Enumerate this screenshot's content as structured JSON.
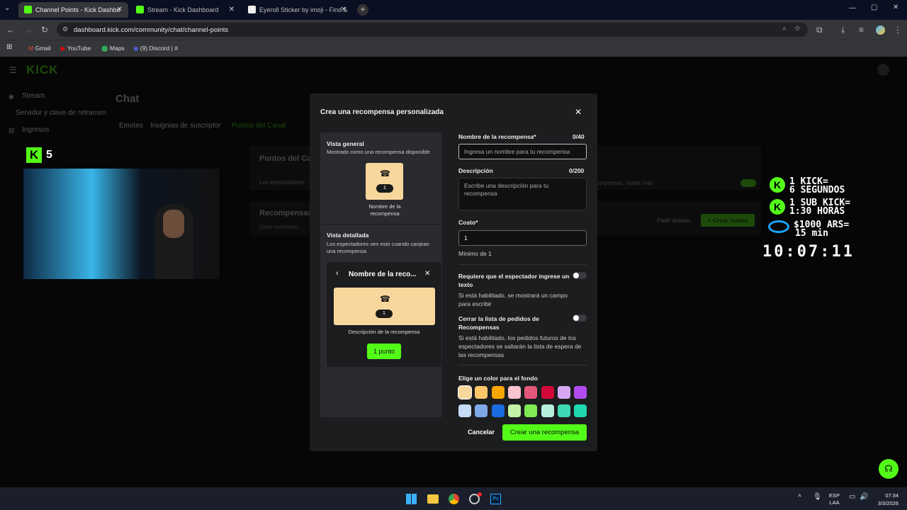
{
  "tabs": [
    {
      "label": "Channel Points - Kick Dashbo",
      "active": true
    },
    {
      "label": "Stream - Kick Dashboard",
      "active": false
    },
    {
      "label": "Eyeroll Sticker by imoji - Find &",
      "active": false
    }
  ],
  "address": {
    "url": "dashboard.kick.com/community/chat/channel-points"
  },
  "bookmarks": [
    "Gmail",
    "YouTube",
    "Maps",
    "(9) Discord | #"
  ],
  "sidebar": {
    "items": [
      "Stream",
      "Servidor y clave de retransm",
      "Ingresos"
    ]
  },
  "page": {
    "title": "Chat",
    "tabs": [
      "Emotes",
      "Insignias de suscriptor",
      "Puntos del Canal"
    ],
    "card1_title": "Puntos del Ca",
    "card1_text": "Los espectadores",
    "card1_text_right": "ompensas. Saber más",
    "card2_title": "Recompensas",
    "card2_text": "Crea recompen",
    "request_list": "Pedir listado",
    "create_new": "+ Crear nuevo"
  },
  "modal": {
    "title": "Crea una recompensa personalizada",
    "preview": {
      "overview_title": "Vista general",
      "overview_desc": "Mostrado como una recompensa disponible",
      "card_cost": "1",
      "card_name": "Nombre de la recompensa",
      "detailed_title": "Vista detallada",
      "detailed_desc": "Los espectadores ven esto cuando canjean una recompensa",
      "detail_header": "Nombre de la reco...",
      "detail_cost": "1",
      "detail_desc": "Descripción de la recompensa",
      "detail_button": "1 punto"
    },
    "form": {
      "name_label": "Nombre de la recompensa*",
      "name_count": "0/40",
      "name_placeholder": "Ingresa un nombre para tu recompensa",
      "desc_label": "Descripción",
      "desc_count": "0/200",
      "desc_placeholder": "Escribe una descripción para tu recompensa",
      "cost_label": "Costo*",
      "cost_value": "1",
      "cost_hint": "Mínimo de 1",
      "req_text_label": "Requiere que el espectador ingrese un texto",
      "req_text_desc": "Si está habilitado, se mostrará un campo para escribir",
      "close_list_label": "Cerrar la lista de pedidos de Recompensas",
      "close_list_desc": "Si está habilitado, los pedidos futuros de los espectadores se saltarán la lista de espera de las recompensas",
      "color_label": "Elige un color para el fondo",
      "colors": [
        "#f9d79c",
        "#fbc56a",
        "#f7a500",
        "#f7c3cf",
        "#e2577a",
        "#d3083a",
        "#d6a8f2",
        "#b34cf0",
        "#c6dcf6",
        "#7fa8e6",
        "#1b6be0",
        "#c3f2a8",
        "#7fea52",
        "#b6f0dc",
        "#3fd8b4",
        "#1ed8b0"
      ],
      "selected_color": "#f9d79c",
      "cancel": "Cancelar",
      "submit": "Crear una recompensa"
    }
  },
  "webcam": {
    "label": "5"
  },
  "overlay": {
    "line1": "1 KICK=",
    "line2": "6 SEGUNDOS",
    "line3": "1 SUB KICK=",
    "line4": "1:30 HORAS",
    "line5": "$1000 ARS=",
    "line6": "15 min",
    "timer": "10:07:11"
  },
  "taskbar": {
    "lang1": "ESP",
    "lang2": "LAA",
    "time": "07:34",
    "date": "3/3/2026"
  },
  "accent": "#53fc18"
}
